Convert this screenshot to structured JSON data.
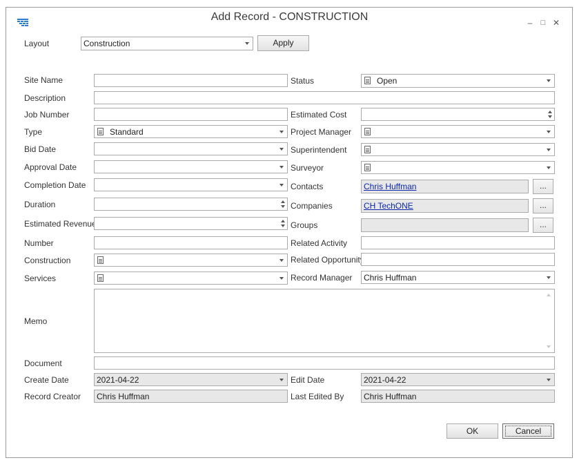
{
  "window": {
    "title": "Add Record - CONSTRUCTION",
    "minimize": "–",
    "maximize": "□",
    "close": "✕"
  },
  "layout": {
    "label": "Layout",
    "value": "Construction",
    "apply_label": "Apply"
  },
  "fields": {
    "site_name": {
      "label": "Site Name",
      "value": ""
    },
    "status": {
      "label": "Status",
      "value": "Open"
    },
    "description": {
      "label": "Description",
      "value": ""
    },
    "job_number": {
      "label": "Job Number",
      "value": ""
    },
    "estimated_cost": {
      "label": "Estimated Cost",
      "value": ""
    },
    "type": {
      "label": "Type",
      "value": "Standard"
    },
    "project_manager": {
      "label": "Project Manager",
      "value": ""
    },
    "bid_date": {
      "label": "Bid Date",
      "value": ""
    },
    "superintendent": {
      "label": "Superintendent",
      "value": ""
    },
    "approval_date": {
      "label": "Approval Date",
      "value": ""
    },
    "surveyor": {
      "label": "Surveyor",
      "value": ""
    },
    "completion_date": {
      "label": "Completion Date",
      "value": ""
    },
    "contacts": {
      "label": "Contacts",
      "value": "Chris Huffman",
      "button": "..."
    },
    "duration": {
      "label": "Duration",
      "value": ""
    },
    "companies": {
      "label": "Companies",
      "value": "CH TechONE",
      "button": "..."
    },
    "estimated_revenue": {
      "label": "Estimated Revenue",
      "value": ""
    },
    "groups": {
      "label": "Groups",
      "value": "",
      "button": "..."
    },
    "number": {
      "label": "Number",
      "value": ""
    },
    "related_activity": {
      "label": "Related Activity",
      "value": ""
    },
    "construction": {
      "label": "Construction",
      "value": ""
    },
    "related_opportunity": {
      "label": "Related Opportunity",
      "value": ""
    },
    "services": {
      "label": "Services",
      "value": ""
    },
    "record_manager": {
      "label": "Record Manager",
      "value": "Chris Huffman"
    },
    "memo": {
      "label": "Memo",
      "value": ""
    },
    "document": {
      "label": "Document",
      "value": ""
    },
    "create_date": {
      "label": "Create Date",
      "value": "2021-04-22"
    },
    "edit_date": {
      "label": "Edit Date",
      "value": "2021-04-22"
    },
    "record_creator": {
      "label": "Record Creator",
      "value": "Chris Huffman"
    },
    "last_edited_by": {
      "label": "Last Edited By",
      "value": "Chris Huffman"
    }
  },
  "footer": {
    "ok_label": "OK",
    "cancel_label": "Cancel"
  },
  "colors": {
    "link": "#0b26a8",
    "readonly_bg": "#e8e8e8",
    "border": "#a9a9a9"
  }
}
